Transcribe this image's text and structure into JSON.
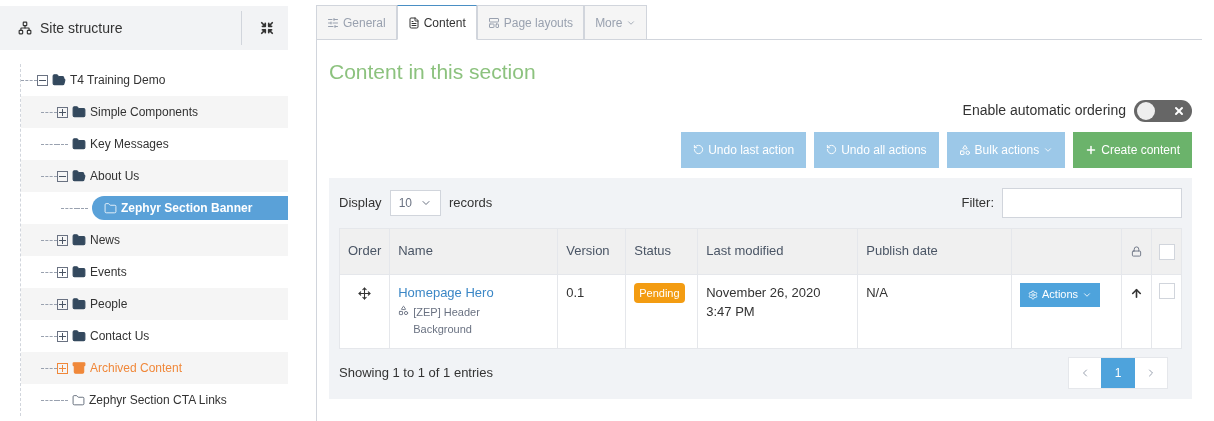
{
  "sidebar": {
    "title": "Site structure",
    "tree": [
      {
        "label": "T4 Training Demo",
        "kind": "folder",
        "expanded": true,
        "selected": false,
        "children": [
          {
            "label": "Simple Components",
            "kind": "folder",
            "expanded": false,
            "selected": false
          },
          {
            "label": "Key Messages",
            "kind": "folder",
            "selected": false
          },
          {
            "label": "About Us",
            "kind": "folder",
            "expanded": true,
            "selected": false,
            "children": [
              {
                "label": "Zephyr Section Banner",
                "kind": "section",
                "selected": true
              }
            ]
          },
          {
            "label": "News",
            "kind": "folder",
            "expanded": false,
            "selected": false
          },
          {
            "label": "Events",
            "kind": "folder",
            "expanded": false,
            "selected": false
          },
          {
            "label": "People",
            "kind": "folder",
            "expanded": false,
            "selected": false
          },
          {
            "label": "Contact Us",
            "kind": "folder",
            "expanded": false,
            "selected": false
          },
          {
            "label": "Archived Content",
            "kind": "archive",
            "expanded": false,
            "selected": false
          },
          {
            "label": "Zephyr Section CTA Links",
            "kind": "section",
            "selected": false
          }
        ]
      }
    ]
  },
  "tabs": [
    {
      "label": "General",
      "kind": "settings",
      "selected": false
    },
    {
      "label": "Content",
      "kind": "content",
      "selected": true
    },
    {
      "label": "Page layouts",
      "kind": "layouts",
      "selected": false
    },
    {
      "label": "More",
      "kind": "menu",
      "selected": false
    }
  ],
  "heading": "Content in this section",
  "ordering": {
    "label": "Enable automatic ordering",
    "on": false
  },
  "buttons": [
    {
      "label": "Undo last action",
      "kind": "undo"
    },
    {
      "label": "Undo all actions",
      "kind": "undo"
    },
    {
      "label": "Bulk actions",
      "kind": "bulk"
    },
    {
      "label": "Create content",
      "kind": "create"
    }
  ],
  "table": {
    "display_label": "Display",
    "page_size": "10",
    "records_label": "records",
    "filter_label": "Filter:",
    "columns": [
      "Order",
      "Name",
      "Version",
      "Status",
      "Last modified",
      "Publish date"
    ],
    "rows": [
      {
        "name": "Homepage Hero",
        "type": "[ZEP] Header Background",
        "version": "0.1",
        "status": "Pending",
        "last_modified": "November 26, 2020 3:47 PM",
        "publish_date": "N/A",
        "action": "Actions",
        "checked": false
      }
    ],
    "select_all_checked": false,
    "info": "Showing 1 to 1 of 1 entries",
    "pages": [
      {
        "label": "1",
        "selected": true
      }
    ]
  }
}
